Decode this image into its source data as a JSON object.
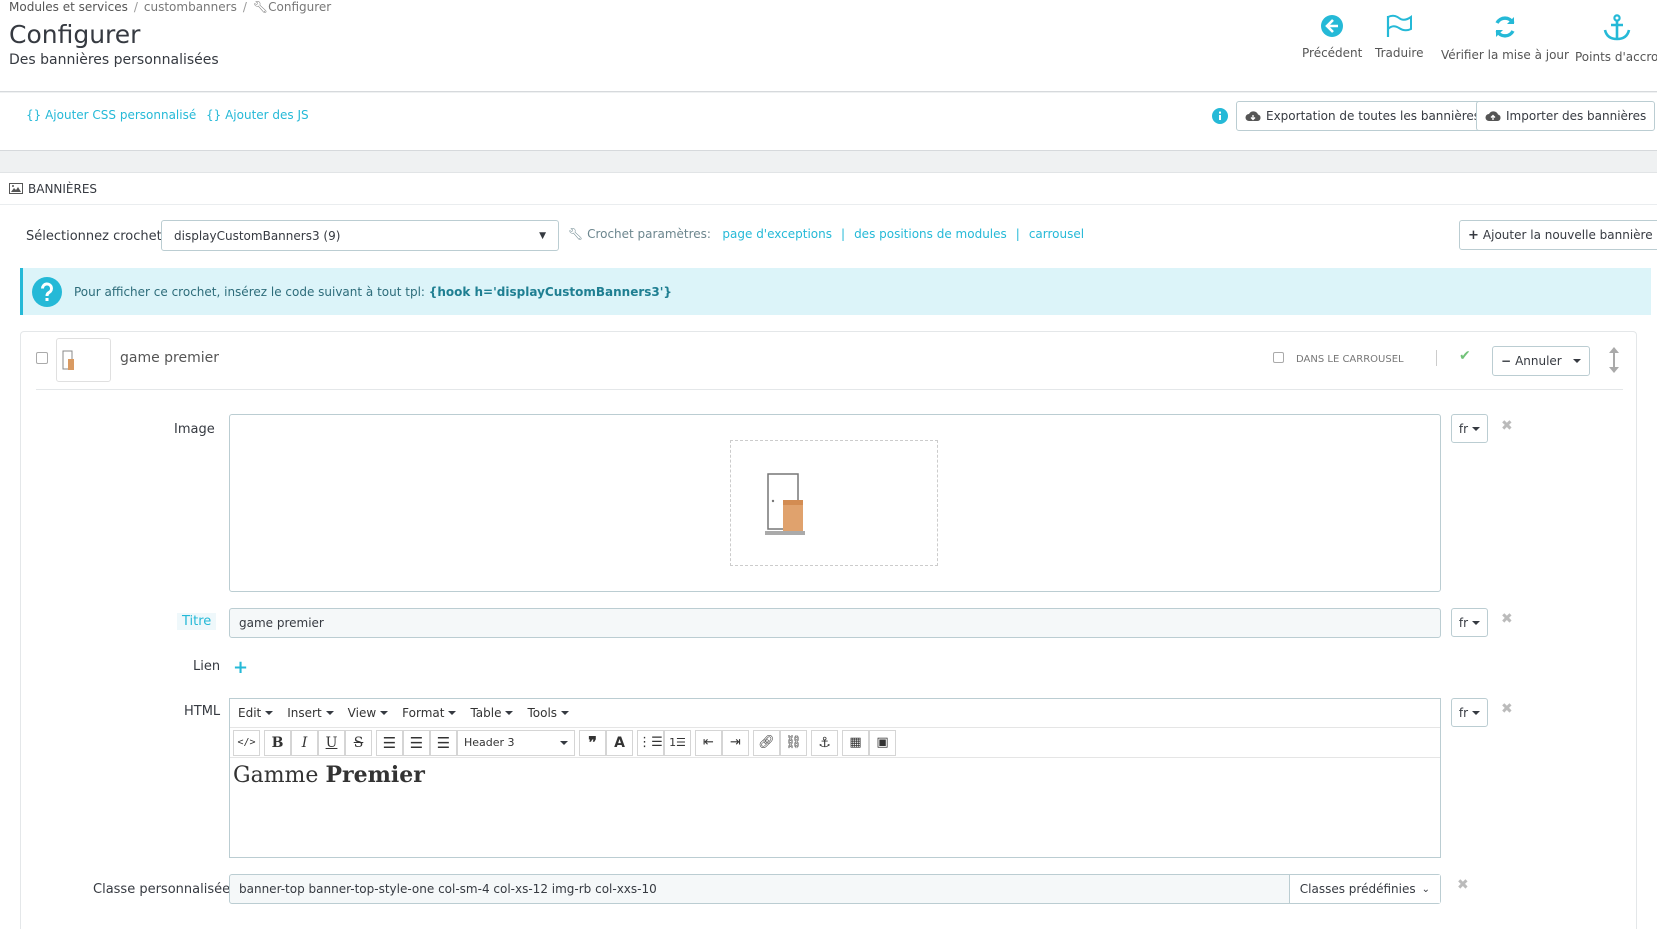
{
  "breadcrumb": [
    "Modules et services",
    "custombanners",
    "Configurer"
  ],
  "page": {
    "title": "Configurer",
    "subtitle": "Des bannières personnalisées"
  },
  "toolbar": [
    {
      "label": "Précédent",
      "icon": "arrow-circle-left-icon"
    },
    {
      "label": "Traduire",
      "icon": "flag-icon"
    },
    {
      "label": "Vérifier la mise à jour",
      "icon": "refresh-icon"
    },
    {
      "label": "Points d'accro",
      "icon": "anchor-icon"
    }
  ],
  "links": {
    "add_css": "{} Ajouter CSS personnalisé",
    "add_js": "{} Ajouter des JS",
    "export_all": "Exportation de toutes les bannières",
    "import": "Importer des bannières"
  },
  "panel": {
    "heading": "Bannières"
  },
  "hook": {
    "label": "Sélectionnez crochet",
    "selected": "displayCustomBanners3 (9)",
    "params_label": "Crochet paramètres:",
    "param_links": [
      "page d'exceptions",
      "des positions de modules",
      "carrousel"
    ],
    "add_banner": "Ajouter la nouvelle bannière"
  },
  "alert": {
    "text": "Pour afficher ce crochet, insérez le code suivant à tout tpl:",
    "code": "{hook h='displayCustomBanners3'}"
  },
  "banner": {
    "title": "game premier",
    "in_carousel": "Dans le carrousel",
    "cancel": "Annuler",
    "fields": {
      "image_label": "Image",
      "title_label": "Titre",
      "title_value": "game premier",
      "link_label": "Lien",
      "html_label": "HTML",
      "class_label": "Classe personnalisée",
      "class_value": "banner-top banner-top-style-one col-sm-4 col-xs-12 img-rb col-xxs-10",
      "predefined": "Classes prédéfinies",
      "lang": "fr"
    },
    "editor": {
      "menus": [
        "Edit",
        "Insert",
        "View",
        "Format",
        "Table",
        "Tools"
      ],
      "block_format": "Header 3",
      "content_plain": "Gamme ",
      "content_bold": "Premier"
    }
  },
  "colors": {
    "accent": "#25b9d7",
    "success": "#72c279",
    "alert_bg": "#dcf4f9"
  }
}
